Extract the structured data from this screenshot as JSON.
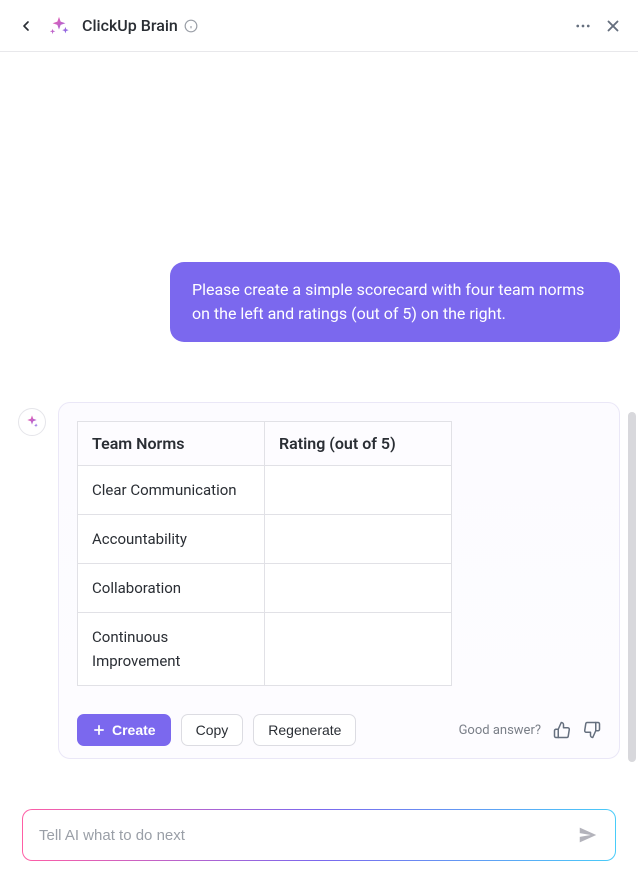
{
  "header": {
    "title": "ClickUp Brain"
  },
  "conversation": {
    "user_message": "Please create a simple scorecard with four team norms on the left and ratings (out of 5) on the right."
  },
  "scorecard": {
    "columns": [
      "Team Norms",
      "Rating (out of 5)"
    ],
    "rows": [
      {
        "norm": "Clear Communication",
        "rating": ""
      },
      {
        "norm": "Accountability",
        "rating": ""
      },
      {
        "norm": "Collaboration",
        "rating": ""
      },
      {
        "norm": "Continuous Improvement",
        "rating": ""
      }
    ]
  },
  "actions": {
    "create": "Create",
    "copy": "Copy",
    "regenerate": "Regenerate",
    "feedback_prompt": "Good answer?"
  },
  "input": {
    "placeholder": "Tell AI what to do next"
  }
}
